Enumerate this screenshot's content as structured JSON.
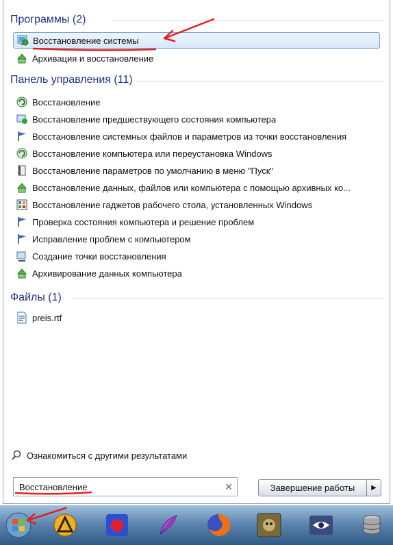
{
  "start_menu": {
    "programs": {
      "header": "Программы (2)",
      "items": [
        {
          "label": "Восстановление системы",
          "icon": "system-restore-icon"
        },
        {
          "label": "Архивация и восстановление",
          "icon": "backup-restore-icon"
        }
      ]
    },
    "control_panel": {
      "header": "Панель управления (11)",
      "items": [
        {
          "label": "Восстановление",
          "icon": "recovery-icon"
        },
        {
          "label": "Восстановление предшествующего состояния компьютера",
          "icon": "restore-point-icon"
        },
        {
          "label": "Восстановление системных файлов и параметров из точки восстановления",
          "icon": "flag-icon"
        },
        {
          "label": "Восстановление компьютера или переустановка Windows",
          "icon": "recovery-icon"
        },
        {
          "label": "Восстановление параметров по умолчанию в меню \"Пуск\"",
          "icon": "taskbar-settings-icon"
        },
        {
          "label": "Восстановление данных, файлов или компьютера с помощью архивных ко...",
          "icon": "backup-restore-icon"
        },
        {
          "label": "Восстановление гаджетов рабочего стола, установленных Windows",
          "icon": "gadgets-icon"
        },
        {
          "label": "Проверка состояния компьютера и решение проблем",
          "icon": "flag-icon"
        },
        {
          "label": "Исправление проблем с компьютером",
          "icon": "flag-icon"
        },
        {
          "label": "Создание точки восстановления",
          "icon": "system-icon"
        },
        {
          "label": "Архивирование данных компьютера",
          "icon": "backup-restore-icon"
        }
      ]
    },
    "files": {
      "header": "Файлы (1)",
      "items": [
        {
          "label": "preis.rtf",
          "icon": "rtf-document-icon"
        }
      ]
    },
    "more_results": "Ознакомиться с другими результатами",
    "search": {
      "value": "Восстановление"
    },
    "shutdown_label": "Завершение работы"
  },
  "taskbar": {
    "icons": [
      "start-orb-icon",
      "archicad-icon",
      "paint-splash-icon",
      "quill-icon",
      "firefox-icon",
      "game-icon",
      "eye-icon",
      "database-icon"
    ]
  },
  "colors": {
    "header": "#1e3287",
    "annotation": "#e02020",
    "selection": "#d6e8fb"
  }
}
